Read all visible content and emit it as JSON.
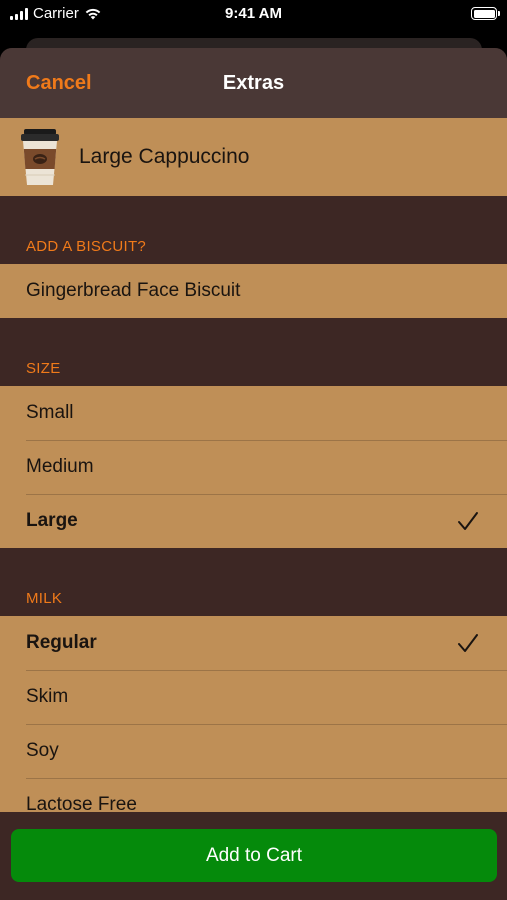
{
  "status_bar": {
    "carrier": "Carrier",
    "time": "9:41 AM"
  },
  "nav": {
    "cancel_label": "Cancel",
    "title": "Extras"
  },
  "product": {
    "name": "Large Cappuccino",
    "icon": "coffee-cup-icon"
  },
  "sections": {
    "biscuit": {
      "header": "ADD A BISCUIT?",
      "items": [
        {
          "label": "Gingerbread Face Biscuit"
        }
      ]
    },
    "size": {
      "header": "SIZE",
      "items": [
        {
          "label": "Small",
          "selected": false
        },
        {
          "label": "Medium",
          "selected": false
        },
        {
          "label": "Large",
          "selected": true
        }
      ]
    },
    "milk": {
      "header": "MILK",
      "items": [
        {
          "label": "Regular",
          "selected": true
        },
        {
          "label": "Skim",
          "selected": false
        },
        {
          "label": "Soy",
          "selected": false
        },
        {
          "label": "Lactose Free",
          "selected": false
        }
      ]
    }
  },
  "cart": {
    "button_label": "Add to Cart"
  },
  "colors": {
    "accent": "#f07a1a",
    "row_background": "#bf8f57",
    "sheet_background": "#3d2724",
    "button": "#058a0b"
  }
}
